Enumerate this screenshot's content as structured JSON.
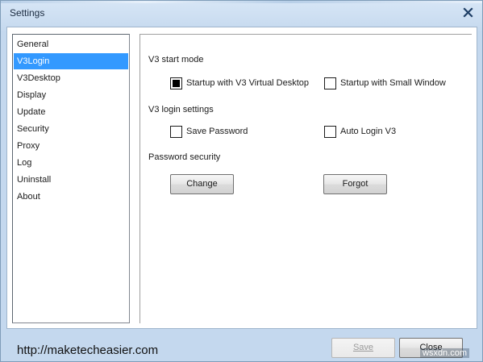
{
  "window": {
    "title": "Settings",
    "close_icon": "close-icon"
  },
  "sidebar": {
    "items": [
      {
        "label": "General",
        "selected": false
      },
      {
        "label": "V3Login",
        "selected": true
      },
      {
        "label": "V3Desktop",
        "selected": false
      },
      {
        "label": "Display",
        "selected": false
      },
      {
        "label": "Update",
        "selected": false
      },
      {
        "label": "Security",
        "selected": false
      },
      {
        "label": "Proxy",
        "selected": false
      },
      {
        "label": "Log",
        "selected": false
      },
      {
        "label": "Uninstall",
        "selected": false
      },
      {
        "label": "About",
        "selected": false
      }
    ],
    "selected_color": "#3399ff"
  },
  "content": {
    "start_mode": {
      "heading": "V3 start mode",
      "options": [
        {
          "label": "Startup with V3 Virtual Desktop",
          "checked": true
        },
        {
          "label": "Startup with Small Window",
          "checked": false
        }
      ]
    },
    "login_settings": {
      "heading": "V3 login settings",
      "options": [
        {
          "label": "Save Password",
          "checked": false
        },
        {
          "label": "Auto Login V3",
          "checked": false
        }
      ]
    },
    "password_security": {
      "heading": "Password security",
      "change_label": "Change",
      "forgot_label": "Forgot"
    }
  },
  "footer": {
    "url": "http://maketecheasier.com",
    "save_label": "Save",
    "save_enabled": false,
    "close_label": "Close",
    "watermark": "wsxdn.com"
  }
}
